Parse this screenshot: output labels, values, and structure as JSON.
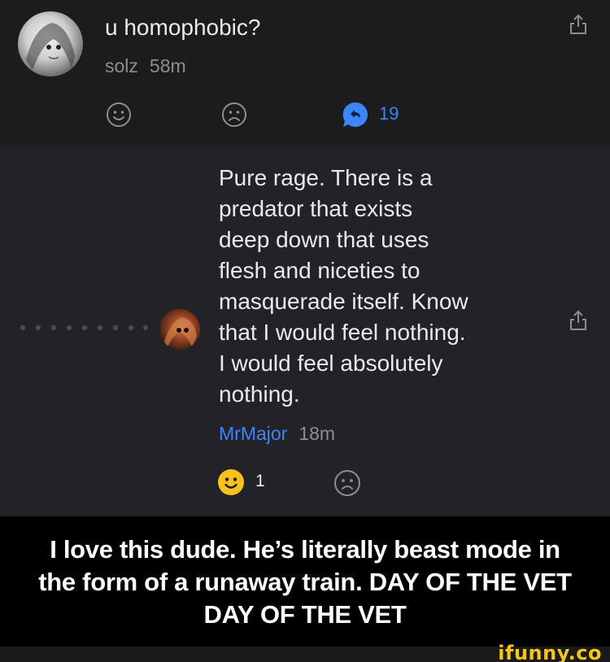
{
  "post": {
    "title": "u homophobic?",
    "username": "solz",
    "time": "58m",
    "reply_count": "19"
  },
  "reply": {
    "lines": [
      "Pure rage. There is a",
      "predator that exists",
      "deep down that uses",
      "flesh and niceties to",
      "masquerade itself. Know",
      "that I would feel nothing.",
      "I would feel absolutely",
      "nothing."
    ],
    "author": "MrMajor",
    "time": "18m",
    "smile_count": "1"
  },
  "caption": {
    "lines": [
      "I love this dude. He’s literally beast mode in",
      "the form of a runaway train. DAY OF THE VET",
      "DAY OF THE VET"
    ]
  },
  "watermark": "ifunny.co",
  "colors": {
    "accent_blue": "#3d84ff",
    "smile_yellow": "#f6c21b",
    "text_primary": "#e9e9ee",
    "text_secondary": "#8d8d93"
  },
  "icons": [
    "share-icon",
    "smile-icon",
    "frown-icon",
    "reply-icon",
    "thread-dots-icon"
  ]
}
